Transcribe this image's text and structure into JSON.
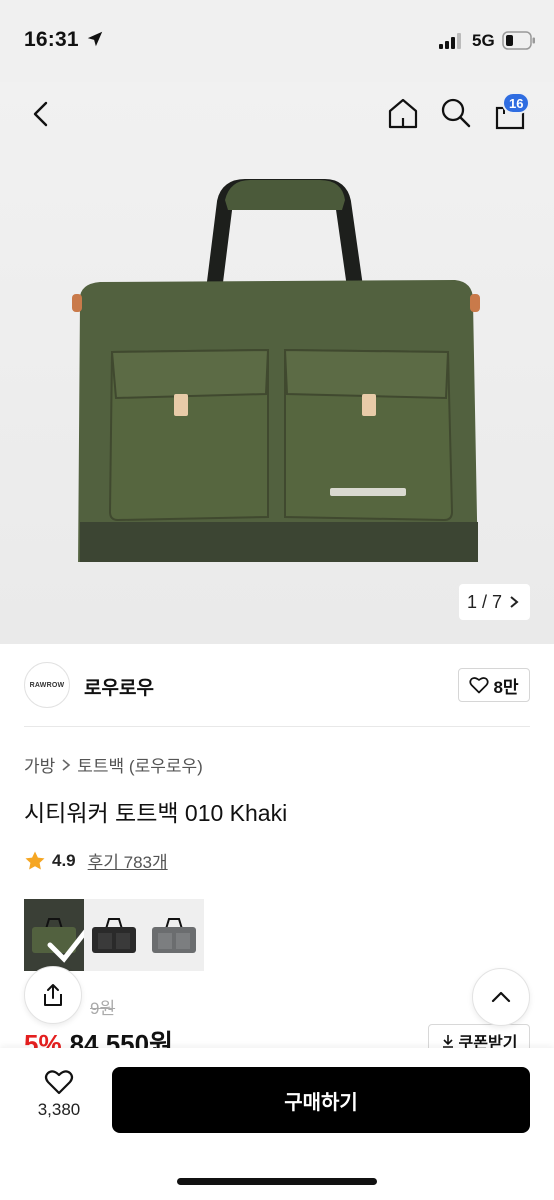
{
  "status_bar": {
    "time": "16:31",
    "network": "5G",
    "icons": [
      "location-arrow-icon",
      "signal-bars-icon",
      "battery-icon"
    ]
  },
  "nav": {
    "cart_count": "16",
    "icons": [
      "back-icon",
      "home-icon",
      "search-icon",
      "cart-icon"
    ]
  },
  "gallery": {
    "counter": "1 / 7"
  },
  "brand": {
    "logo_text": "RAWROW",
    "name": "로우로우",
    "like_count": "8만"
  },
  "breadcrumb": {
    "category": "가방",
    "subcategory": "토트백 (로우로우)"
  },
  "product": {
    "title": "시티워커 토트백 010 Khaki",
    "rating": "4.9",
    "reviews": "후기 783개",
    "color_swatches": [
      "Khaki",
      "Black",
      "Grey"
    ],
    "original_price_visible": "9원",
    "discount": "5%",
    "price": "84,550원",
    "coupon_label": "쿠폰받기"
  },
  "bottom_bar": {
    "wish_count": "3,380",
    "buy_label": "구매하기"
  },
  "colors": {
    "accent_blue": "#2f6de1",
    "discount_red": "#e41f1f",
    "khaki": "#4b5a3a",
    "star": "#f5a623"
  }
}
